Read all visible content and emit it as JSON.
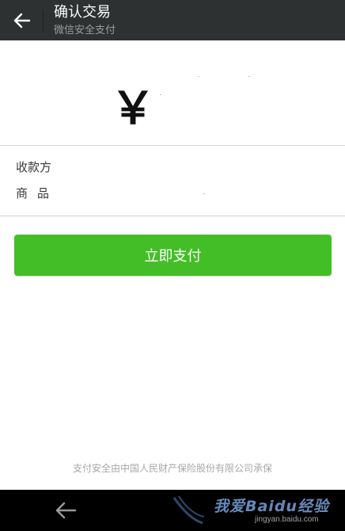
{
  "header": {
    "title": "确认交易",
    "subtitle": "微信安全支付"
  },
  "payment": {
    "currency_symbol": "￥",
    "pay_button_label": "立即支付"
  },
  "details": {
    "payee_label": "收款方",
    "goods_label": "商品"
  },
  "footer": {
    "notice": "支付安全由中国人民财产保险股份有限公司承保"
  },
  "watermark": {
    "brand": "我爱Baidu经验",
    "url": "jingyan.baidu.com"
  },
  "colors": {
    "titlebar": "#2e3132",
    "pay_button": "#44be26",
    "navbar": "#000000"
  },
  "icons": {
    "back": "arrow-left-icon",
    "nav_back": "nav-back-icon"
  }
}
